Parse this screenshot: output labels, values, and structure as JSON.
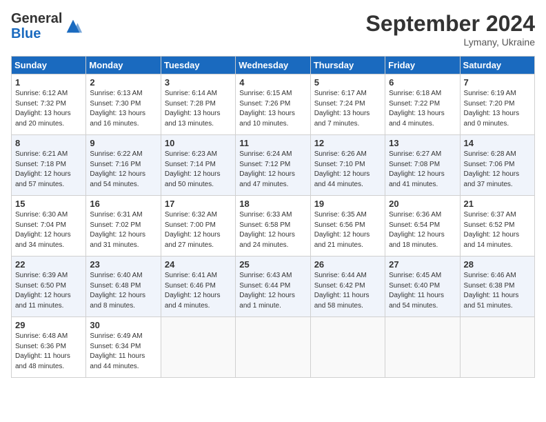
{
  "header": {
    "logo_general": "General",
    "logo_blue": "Blue",
    "month_title": "September 2024",
    "location": "Lymany, Ukraine"
  },
  "weekdays": [
    "Sunday",
    "Monday",
    "Tuesday",
    "Wednesday",
    "Thursday",
    "Friday",
    "Saturday"
  ],
  "weeks": [
    [
      {
        "day": "1",
        "info": "Sunrise: 6:12 AM\nSunset: 7:32 PM\nDaylight: 13 hours\nand 20 minutes."
      },
      {
        "day": "2",
        "info": "Sunrise: 6:13 AM\nSunset: 7:30 PM\nDaylight: 13 hours\nand 16 minutes."
      },
      {
        "day": "3",
        "info": "Sunrise: 6:14 AM\nSunset: 7:28 PM\nDaylight: 13 hours\nand 13 minutes."
      },
      {
        "day": "4",
        "info": "Sunrise: 6:15 AM\nSunset: 7:26 PM\nDaylight: 13 hours\nand 10 minutes."
      },
      {
        "day": "5",
        "info": "Sunrise: 6:17 AM\nSunset: 7:24 PM\nDaylight: 13 hours\nand 7 minutes."
      },
      {
        "day": "6",
        "info": "Sunrise: 6:18 AM\nSunset: 7:22 PM\nDaylight: 13 hours\nand 4 minutes."
      },
      {
        "day": "7",
        "info": "Sunrise: 6:19 AM\nSunset: 7:20 PM\nDaylight: 13 hours\nand 0 minutes."
      }
    ],
    [
      {
        "day": "8",
        "info": "Sunrise: 6:21 AM\nSunset: 7:18 PM\nDaylight: 12 hours\nand 57 minutes."
      },
      {
        "day": "9",
        "info": "Sunrise: 6:22 AM\nSunset: 7:16 PM\nDaylight: 12 hours\nand 54 minutes."
      },
      {
        "day": "10",
        "info": "Sunrise: 6:23 AM\nSunset: 7:14 PM\nDaylight: 12 hours\nand 50 minutes."
      },
      {
        "day": "11",
        "info": "Sunrise: 6:24 AM\nSunset: 7:12 PM\nDaylight: 12 hours\nand 47 minutes."
      },
      {
        "day": "12",
        "info": "Sunrise: 6:26 AM\nSunset: 7:10 PM\nDaylight: 12 hours\nand 44 minutes."
      },
      {
        "day": "13",
        "info": "Sunrise: 6:27 AM\nSunset: 7:08 PM\nDaylight: 12 hours\nand 41 minutes."
      },
      {
        "day": "14",
        "info": "Sunrise: 6:28 AM\nSunset: 7:06 PM\nDaylight: 12 hours\nand 37 minutes."
      }
    ],
    [
      {
        "day": "15",
        "info": "Sunrise: 6:30 AM\nSunset: 7:04 PM\nDaylight: 12 hours\nand 34 minutes."
      },
      {
        "day": "16",
        "info": "Sunrise: 6:31 AM\nSunset: 7:02 PM\nDaylight: 12 hours\nand 31 minutes."
      },
      {
        "day": "17",
        "info": "Sunrise: 6:32 AM\nSunset: 7:00 PM\nDaylight: 12 hours\nand 27 minutes."
      },
      {
        "day": "18",
        "info": "Sunrise: 6:33 AM\nSunset: 6:58 PM\nDaylight: 12 hours\nand 24 minutes."
      },
      {
        "day": "19",
        "info": "Sunrise: 6:35 AM\nSunset: 6:56 PM\nDaylight: 12 hours\nand 21 minutes."
      },
      {
        "day": "20",
        "info": "Sunrise: 6:36 AM\nSunset: 6:54 PM\nDaylight: 12 hours\nand 18 minutes."
      },
      {
        "day": "21",
        "info": "Sunrise: 6:37 AM\nSunset: 6:52 PM\nDaylight: 12 hours\nand 14 minutes."
      }
    ],
    [
      {
        "day": "22",
        "info": "Sunrise: 6:39 AM\nSunset: 6:50 PM\nDaylight: 12 hours\nand 11 minutes."
      },
      {
        "day": "23",
        "info": "Sunrise: 6:40 AM\nSunset: 6:48 PM\nDaylight: 12 hours\nand 8 minutes."
      },
      {
        "day": "24",
        "info": "Sunrise: 6:41 AM\nSunset: 6:46 PM\nDaylight: 12 hours\nand 4 minutes."
      },
      {
        "day": "25",
        "info": "Sunrise: 6:43 AM\nSunset: 6:44 PM\nDaylight: 12 hours\nand 1 minute."
      },
      {
        "day": "26",
        "info": "Sunrise: 6:44 AM\nSunset: 6:42 PM\nDaylight: 11 hours\nand 58 minutes."
      },
      {
        "day": "27",
        "info": "Sunrise: 6:45 AM\nSunset: 6:40 PM\nDaylight: 11 hours\nand 54 minutes."
      },
      {
        "day": "28",
        "info": "Sunrise: 6:46 AM\nSunset: 6:38 PM\nDaylight: 11 hours\nand 51 minutes."
      }
    ],
    [
      {
        "day": "29",
        "info": "Sunrise: 6:48 AM\nSunset: 6:36 PM\nDaylight: 11 hours\nand 48 minutes."
      },
      {
        "day": "30",
        "info": "Sunrise: 6:49 AM\nSunset: 6:34 PM\nDaylight: 11 hours\nand 44 minutes."
      },
      {
        "day": "",
        "info": ""
      },
      {
        "day": "",
        "info": ""
      },
      {
        "day": "",
        "info": ""
      },
      {
        "day": "",
        "info": ""
      },
      {
        "day": "",
        "info": ""
      }
    ]
  ]
}
